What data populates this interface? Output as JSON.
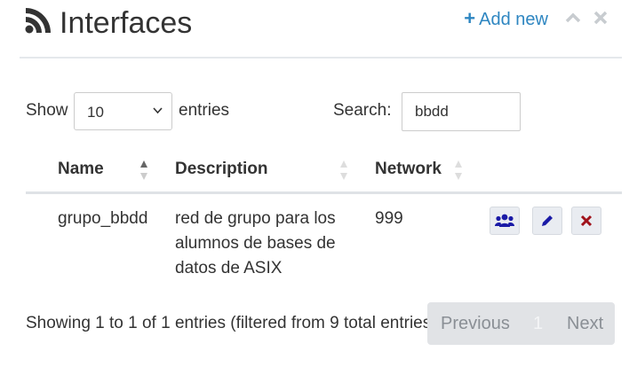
{
  "header": {
    "title": "Interfaces",
    "add_new_label": "Add new",
    "icons": {
      "title": "rss-icon",
      "collapse": "chevron-up-icon",
      "close": "close-icon"
    }
  },
  "length_menu": {
    "show_label": "Show",
    "selected": "10",
    "entries_label": "entries"
  },
  "search": {
    "label": "Search:",
    "value": "bbdd"
  },
  "table": {
    "columns": [
      "Name",
      "Description",
      "Network"
    ],
    "rows": [
      {
        "name": "grupo_bbdd",
        "description_lines": [
          "red de grupo para los",
          "alumnos de bases de",
          "datos de ASIX"
        ],
        "network": "999",
        "actions": [
          "users-icon",
          "pencil-icon",
          "delete-icon"
        ]
      }
    ]
  },
  "footer": {
    "info": "Showing 1 to 1 of 1 entries (filtered from 9 total entries)",
    "previous_label": "Previous",
    "current_page": "1",
    "next_label": "Next"
  },
  "colors": {
    "accent": "#2e86c1",
    "action_blue": "#1a1aa6",
    "action_red": "#a0121b",
    "pager_bg": "#e1e3e6"
  }
}
